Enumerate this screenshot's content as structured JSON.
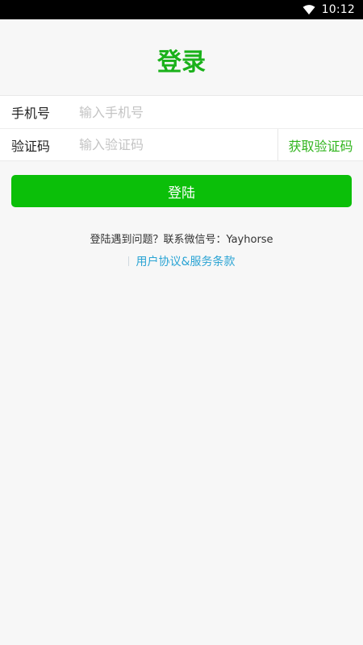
{
  "status_bar": {
    "time": "10:12"
  },
  "page": {
    "title": "登录"
  },
  "form": {
    "phone": {
      "label": "手机号",
      "placeholder": "输入手机号",
      "value": ""
    },
    "code": {
      "label": "验证码",
      "placeholder": "输入验证码",
      "value": "",
      "get_code_label": "获取验证码"
    }
  },
  "login_button_label": "登陆",
  "help": {
    "text": "登陆遇到问题？联系微信号：Yayhorse"
  },
  "agreement": {
    "link_text": "用户协议&服务条款"
  },
  "colors": {
    "title_green": "#1ab11a",
    "button_green": "#0bbf09",
    "link_blue": "#2ba4d4"
  }
}
